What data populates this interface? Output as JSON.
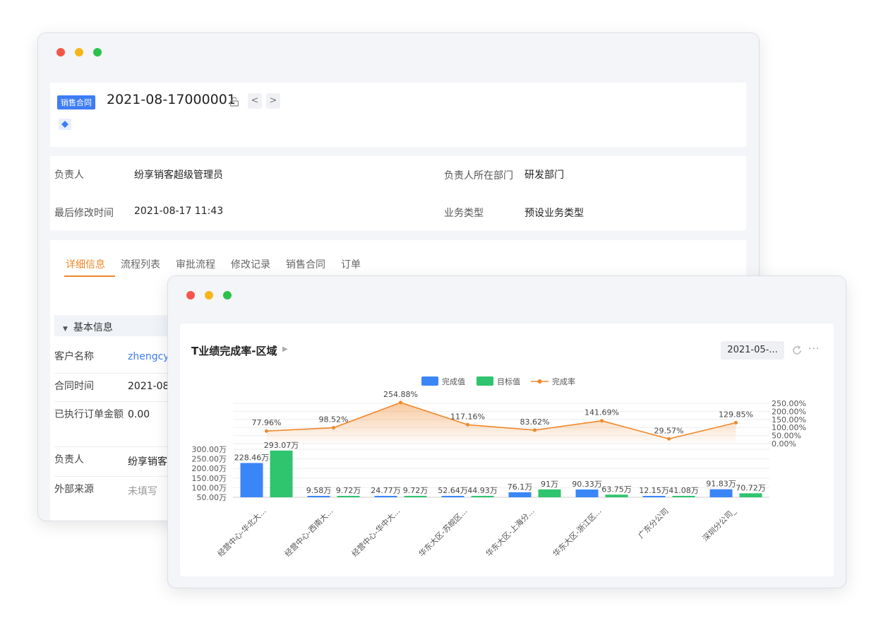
{
  "record": {
    "type_badge": "销售合同",
    "number": "2021-08-17000001",
    "nav_prev": "<",
    "nav_next": ">"
  },
  "info": {
    "owner_label": "负责人",
    "owner_value": "纷享销客超级管理员",
    "dept_label": "负责人所在部门",
    "dept_value": "研发部门",
    "modified_label": "最后修改时间",
    "modified_value": "2021-08-17 11:43",
    "biztype_label": "业务类型",
    "biztype_value": "预设业务类型"
  },
  "tabs": [
    "详细信息",
    "流程列表",
    "审批流程",
    "修改记录",
    "销售合同",
    "订单"
  ],
  "basic": {
    "section_title": "基本信息",
    "rows": [
      {
        "label": "客户名称",
        "value": "zhengcy",
        "link": true
      },
      {
        "label": "合同时间",
        "value": "2021-08",
        "link": false
      },
      {
        "label": "已执行订单金额",
        "value": "0.00",
        "link": false
      },
      {
        "label": "负责人",
        "value": "纷享销客",
        "link": false
      },
      {
        "label": "外部来源",
        "value": "未填写",
        "link": false
      }
    ]
  },
  "chart_card": {
    "title": "T业绩完成率-区域",
    "date_filter": "2021-05-..."
  },
  "colors": {
    "accent": "#f0882a",
    "blue": "#3b86f7",
    "green": "#2fc46e",
    "link": "#3e7df5"
  },
  "chart_data": {
    "type": "bar",
    "legend_position": "top",
    "categories": [
      "经营中心-华北大...",
      "经营中心-西南大...",
      "经营中心-华中大...",
      "华东大区-苏皖区...",
      "华东大区-上海分...",
      "华东大区-浙江区...",
      "广东分公司",
      "深圳分公司_"
    ],
    "series": [
      {
        "name": "完成值",
        "kind": "bar",
        "values": [
          228.46,
          9.58,
          24.77,
          52.64,
          76.1,
          90.33,
          12.15,
          91.83
        ],
        "labels": [
          "228.46万",
          "9.58万",
          "24.77万",
          "52.64万",
          "76.1万",
          "90.33万",
          "12.15万",
          "91.83万"
        ]
      },
      {
        "name": "目标值",
        "kind": "bar",
        "values": [
          293.07,
          9.72,
          9.72,
          44.93,
          91,
          63.75,
          41.08,
          70.72
        ],
        "labels": [
          "293.07万",
          "9.72万",
          "9.72万",
          "44.93万",
          "91万",
          "63.75万",
          "41.08万",
          "70.72万"
        ]
      },
      {
        "name": "完成率",
        "kind": "line",
        "values": [
          77.96,
          98.52,
          254.88,
          117.16,
          83.62,
          141.69,
          29.57,
          129.85
        ],
        "labels": [
          "77.96%",
          "98.52%",
          "254.88%",
          "117.16%",
          "83.62%",
          "141.69%",
          "29.57%",
          "129.85%"
        ]
      }
    ],
    "y_left": {
      "ticks": [
        "300.00万",
        "250.00万",
        "200.00万",
        "150.00万",
        "100.00万",
        "50.00万"
      ],
      "min": 50,
      "max": 300
    },
    "y_right": {
      "ticks": [
        "250.00%",
        "200.00%",
        "150.00%",
        "100.00%",
        "50.00%",
        "0.00%"
      ],
      "min": 0,
      "max": 250
    },
    "grid": true
  }
}
